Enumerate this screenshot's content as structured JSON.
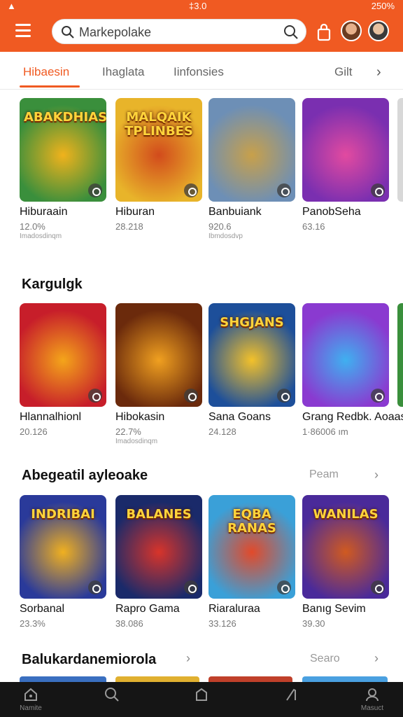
{
  "status_bar": {
    "left": "▲",
    "center": "‡3.0",
    "right": "250%"
  },
  "search": {
    "placeholder": "Markepolake"
  },
  "tabs": {
    "items": [
      "Hibaesin",
      "Ihaglata",
      "Iinfonsies",
      "Gilt"
    ]
  },
  "sections": [
    {
      "title": "",
      "link": "",
      "cards": [
        {
          "name": "Hiburaain",
          "meta": "12.0%",
          "sub": "Imadosdinqm",
          "art_text": "ABAKDHIAS",
          "bg": "#3a8f3c",
          "bg2": "#f0b21c"
        },
        {
          "name": "Hiburan",
          "meta": "28.218",
          "sub": "",
          "art_text": "MALQAIK TPLINBES",
          "bg": "#e8b42a",
          "bg2": "#d24b1c"
        },
        {
          "name": "Banbuiank",
          "meta": "920.6",
          "sub": "Ibmdosdvp",
          "art_text": "",
          "bg": "#6d8fb6",
          "bg2": "#c8a04a"
        },
        {
          "name": "PanobSeha",
          "meta": "63.16",
          "sub": "",
          "art_text": "",
          "bg": "#7a2fb0",
          "bg2": "#e24aa0"
        }
      ]
    },
    {
      "title": "Kargulgk",
      "link": "",
      "cards": [
        {
          "name": "Hlannalhionl",
          "meta": "20.126",
          "sub": "",
          "art_text": "",
          "bg": "#c71e2a",
          "bg2": "#f4a51a"
        },
        {
          "name": "Hibokasin",
          "meta": "22.7%",
          "sub": "Imadosdinqm",
          "art_text": "",
          "bg": "#6b2a0c",
          "bg2": "#f0a020"
        },
        {
          "name": "Sana Goans",
          "meta": "24.128",
          "sub": "",
          "art_text": "SHGJANS",
          "bg": "#1d4f9a",
          "bg2": "#f3c12a"
        },
        {
          "name": "Grang Redbk. Aoaas",
          "meta": "1·86006 ım",
          "sub": "",
          "art_text": "",
          "bg": "#8a3ad0",
          "bg2": "#3fb0f0"
        }
      ]
    },
    {
      "title": "Abegeatil ayleoake",
      "link": "Peam",
      "cards": [
        {
          "name": "Sorbanal",
          "meta": "23.3%",
          "sub": "",
          "art_text": "INDRIBAI",
          "bg": "#2a3a9a",
          "bg2": "#f0b020"
        },
        {
          "name": "Rapro Gama",
          "meta": "38.086",
          "sub": "",
          "art_text": "BALANES",
          "bg": "#1a2a6a",
          "bg2": "#d8342a"
        },
        {
          "name": "Riaraluraa",
          "meta": "33.126",
          "sub": "",
          "art_text": "EQBA RANAS",
          "bg": "#3aa0d8",
          "bg2": "#e24a2a"
        },
        {
          "name": "Banıg Sevim",
          "meta": "39.30",
          "sub": "",
          "art_text": "WANILAS",
          "bg": "#4a2a9a",
          "bg2": "#d05a20"
        }
      ]
    },
    {
      "title": "Balukardanemiorola",
      "link": "Searo",
      "cards": []
    }
  ],
  "nav": {
    "items": [
      "Namite",
      "",
      "",
      "",
      "Masuct"
    ]
  },
  "colors": {
    "accent": "#f05a22",
    "navbar": "#151515"
  }
}
